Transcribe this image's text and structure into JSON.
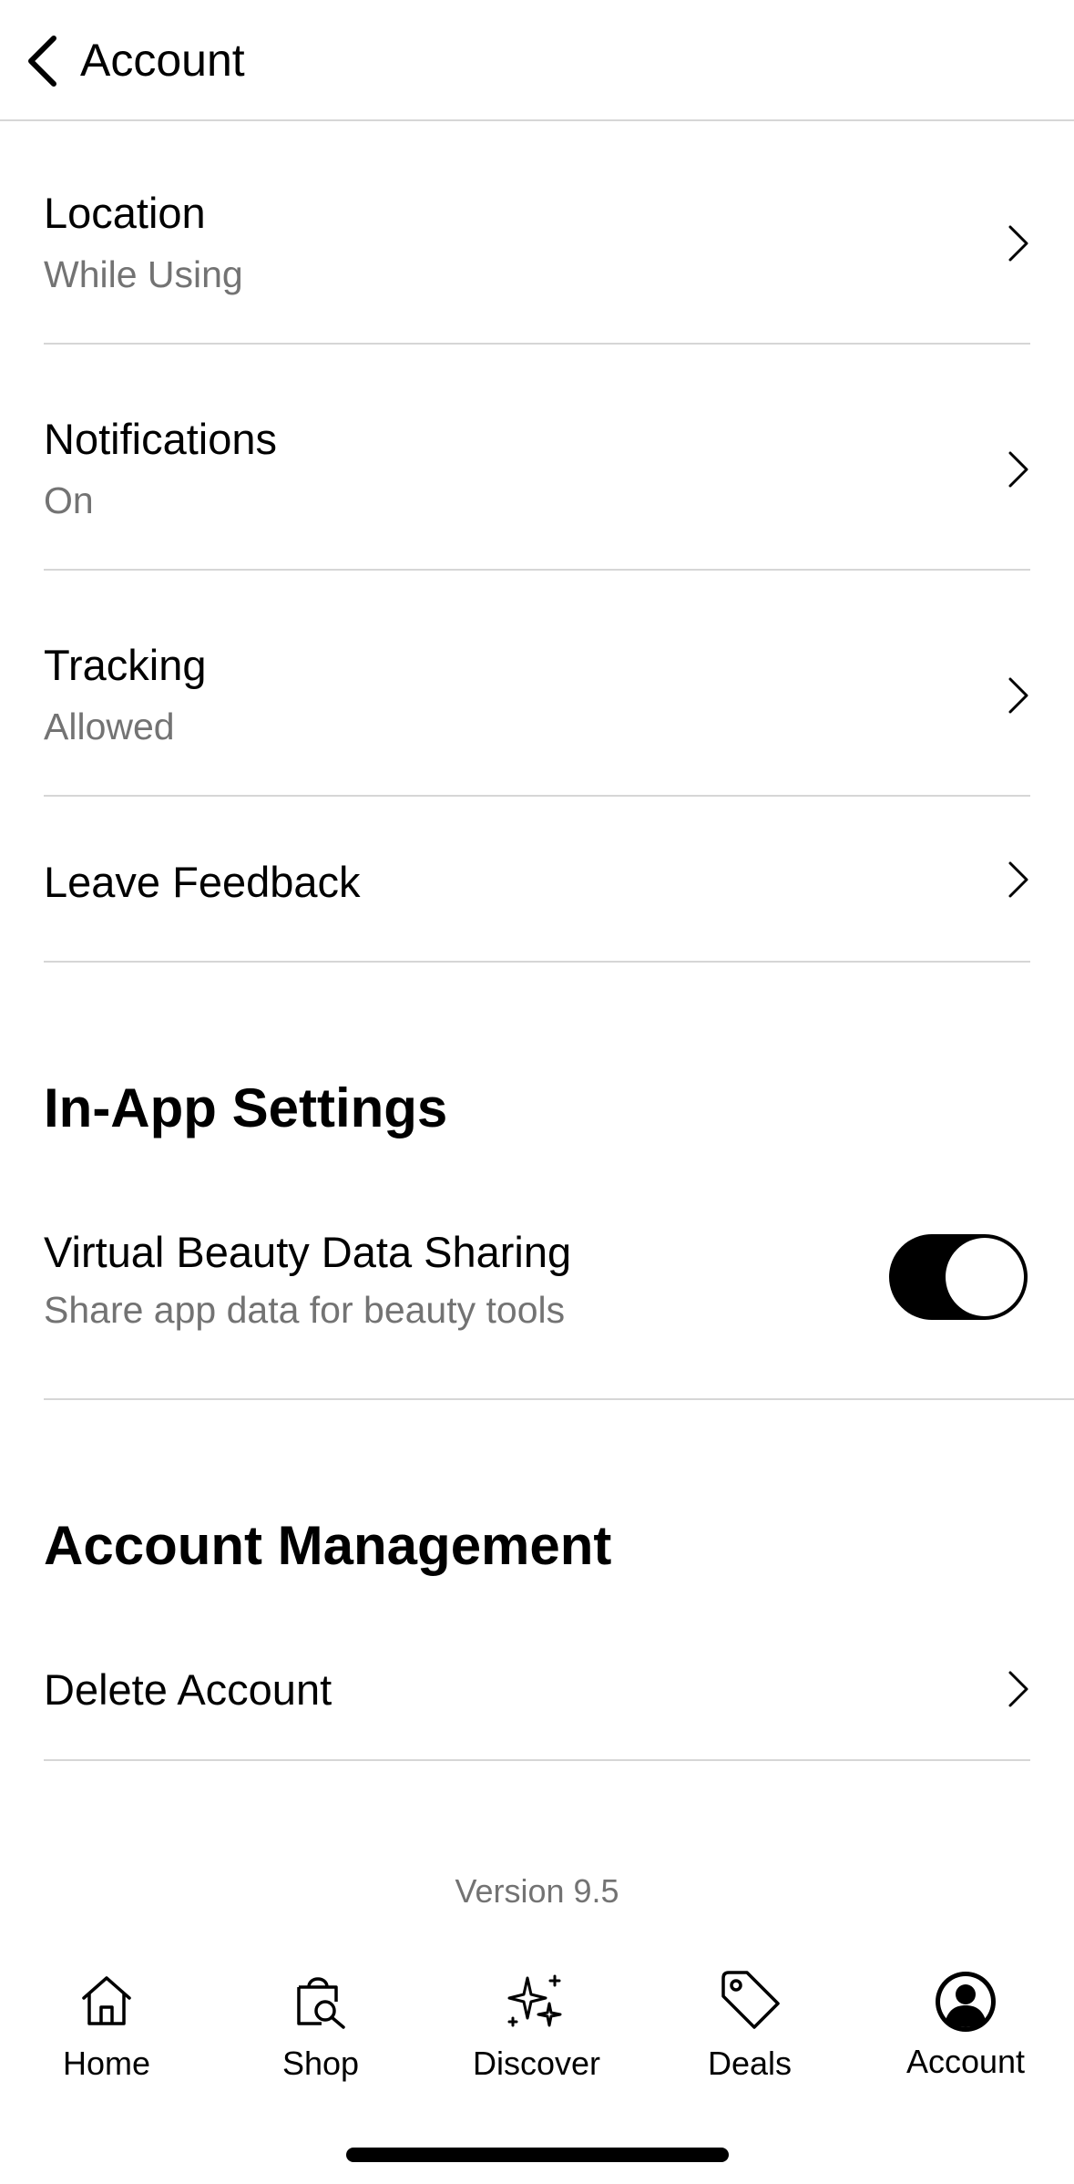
{
  "header": {
    "title": "Account"
  },
  "rows": [
    {
      "label": "Location",
      "value": "While Using"
    },
    {
      "label": "Notifications",
      "value": "On"
    },
    {
      "label": "Tracking",
      "value": "Allowed"
    },
    {
      "label": "Leave Feedback"
    }
  ],
  "in_app_settings": {
    "title": "In-App Settings",
    "virtual_beauty": {
      "label": "Virtual Beauty Data Sharing",
      "description": "Share app data for beauty tools",
      "enabled": true
    }
  },
  "account_management": {
    "title": "Account Management",
    "delete_label": "Delete Account"
  },
  "version": "Version 9.5",
  "tabbar": {
    "items": [
      {
        "label": "Home",
        "icon": "home-icon"
      },
      {
        "label": "Shop",
        "icon": "shopping-bag-search-icon"
      },
      {
        "label": "Discover",
        "icon": "sparkles-icon"
      },
      {
        "label": "Deals",
        "icon": "tag-icon"
      },
      {
        "label": "Account",
        "icon": "user-circle-icon"
      }
    ],
    "active": "Account"
  }
}
